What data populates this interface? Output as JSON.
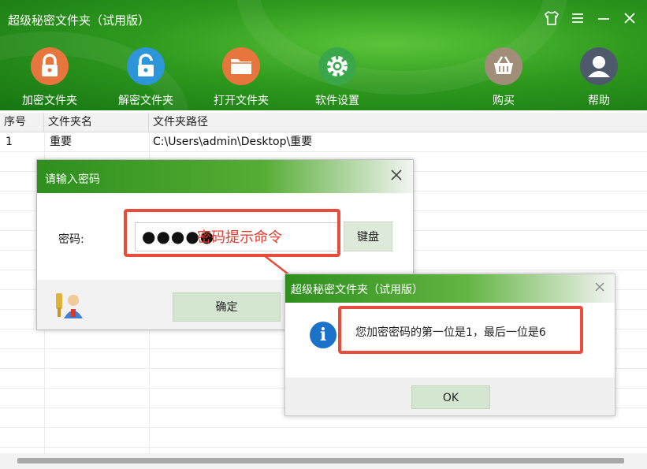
{
  "app": {
    "title": "超级秘密文件夹（试用版）"
  },
  "toolbar": {
    "items": [
      {
        "label": "加密文件夹",
        "icon": "lock-closed-icon",
        "color": "#e6763d"
      },
      {
        "label": "解密文件夹",
        "icon": "lock-open-icon",
        "color": "#2d96d8"
      },
      {
        "label": "打开文件夹",
        "icon": "folder-icon",
        "color": "#e6763d"
      },
      {
        "label": "软件设置",
        "icon": "gear-icon",
        "color": "#3aa84a"
      },
      {
        "label": "购买",
        "icon": "basket-icon",
        "color": "#a08e78"
      },
      {
        "label": "帮助",
        "icon": "user-icon",
        "color": "#4e5a6b"
      }
    ]
  },
  "table": {
    "columns": [
      "序号",
      "文件夹名",
      "文件夹路径"
    ],
    "rows": [
      {
        "index": "1",
        "name": "重要",
        "path": "C:\\Users\\admin\\Desktop\\重要"
      }
    ]
  },
  "password_dialog": {
    "title": "请输入密码",
    "password_label": "密码:",
    "password_masked": "●●●●●",
    "keyboard_button": "键盘",
    "ok_button": "确定"
  },
  "annotation": {
    "hint": "密码提示命令",
    "color": "#e94b3c"
  },
  "info_dialog": {
    "title": "超级秘密文件夹（试用版）",
    "message": "您加密密码的第一位是1，最后一位是6",
    "ok_button": "OK"
  }
}
